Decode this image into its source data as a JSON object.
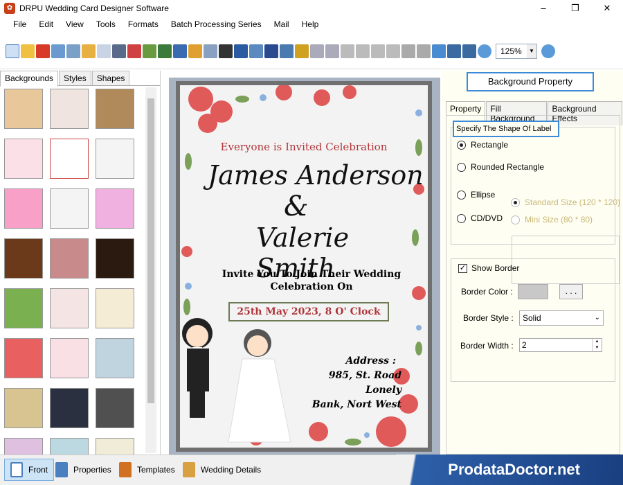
{
  "window": {
    "title": "DRPU Wedding Card Designer Software",
    "minimize": "–",
    "restore": "❐",
    "close": "✕"
  },
  "menu": [
    "File",
    "Edit",
    "View",
    "Tools",
    "Formats",
    "Batch Processing Series",
    "Mail",
    "Help"
  ],
  "toolbar": {
    "zoom": "125%"
  },
  "left_tabs": [
    "Backgrounds",
    "Styles",
    "Shapes"
  ],
  "card": {
    "invited": "Everyone is Invited Celebration",
    "name1": "James Anderson",
    "amp": "&",
    "name2": "Valerie Smith",
    "invite_line1": "Invite You To Join Their Wedding",
    "invite_line2": "Celebration On",
    "date": "25th May 2023, 8 O' Clock",
    "address_label": "Address :",
    "address_line1": "985, St. Road Lonely",
    "address_line2": "Bank, Nort West"
  },
  "right": {
    "title": "Background Property",
    "tabs": [
      "Property",
      "Fill Background",
      "Background Effects"
    ],
    "shape_label": "Specify The Shape Of Label",
    "shapes": [
      "Rectangle",
      "Rounded Rectangle",
      "Ellipse",
      "CD/DVD"
    ],
    "sizes": [
      "Standard Size (120 * 120)",
      "Mini Size (80 * 80)"
    ],
    "show_border": "Show Border",
    "border_color_label": "Border Color :",
    "border_color_btn": ". . .",
    "border_style_label": "Border Style :",
    "border_style_value": "Solid",
    "border_width_label": "Border Width :",
    "border_width_value": "2"
  },
  "bottom": {
    "front": "Front",
    "properties": "Properties",
    "templates": "Templates",
    "details": "Wedding Details",
    "brand": "ProdataDoctor.net"
  },
  "colors": {
    "accent_blue": "#3a8ad8",
    "card_red": "#b0363a",
    "disabled": "#c8b878"
  }
}
